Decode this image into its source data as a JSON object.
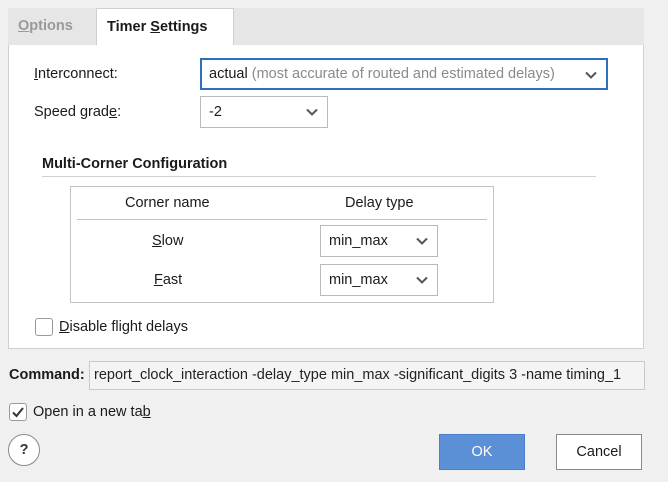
{
  "tabs": {
    "options": {
      "pre": "",
      "mn": "O",
      "post": "ptions"
    },
    "timer": {
      "pre": "Timer ",
      "mn": "S",
      "post": "ettings"
    }
  },
  "fields": {
    "interconnect": {
      "label": {
        "pre": "",
        "mn": "I",
        "post": "nterconnect:"
      },
      "value": "actual",
      "hint": "(most accurate of routed and estimated delays)"
    },
    "speed_grade": {
      "label": {
        "pre": "Speed grad",
        "mn": "e",
        "post": ":"
      },
      "value": "-2"
    }
  },
  "multi_corner": {
    "title": "Multi-Corner Configuration",
    "headers": {
      "corner": "Corner name",
      "delay": "Delay type"
    },
    "rows": [
      {
        "name": {
          "pre": "",
          "mn": "S",
          "post": "low"
        },
        "delay": "min_max"
      },
      {
        "name": {
          "pre": "",
          "mn": "F",
          "post": "ast"
        },
        "delay": "min_max"
      }
    ]
  },
  "disable_flight": {
    "pre": "",
    "mn": "D",
    "post": "isable flight delays",
    "checked": false
  },
  "command": {
    "label": "Command:",
    "value": "report_clock_interaction -delay_type min_max -significant_digits 3 -name timing_1"
  },
  "open_new_tab": {
    "pre": "Open in a new ta",
    "mn": "b",
    "post": "",
    "checked": true
  },
  "buttons": {
    "help": "?",
    "ok": "OK",
    "cancel": "Cancel"
  },
  "colors": {
    "accent": "#2f6fbf",
    "ok_button": "#5b8fd6"
  }
}
